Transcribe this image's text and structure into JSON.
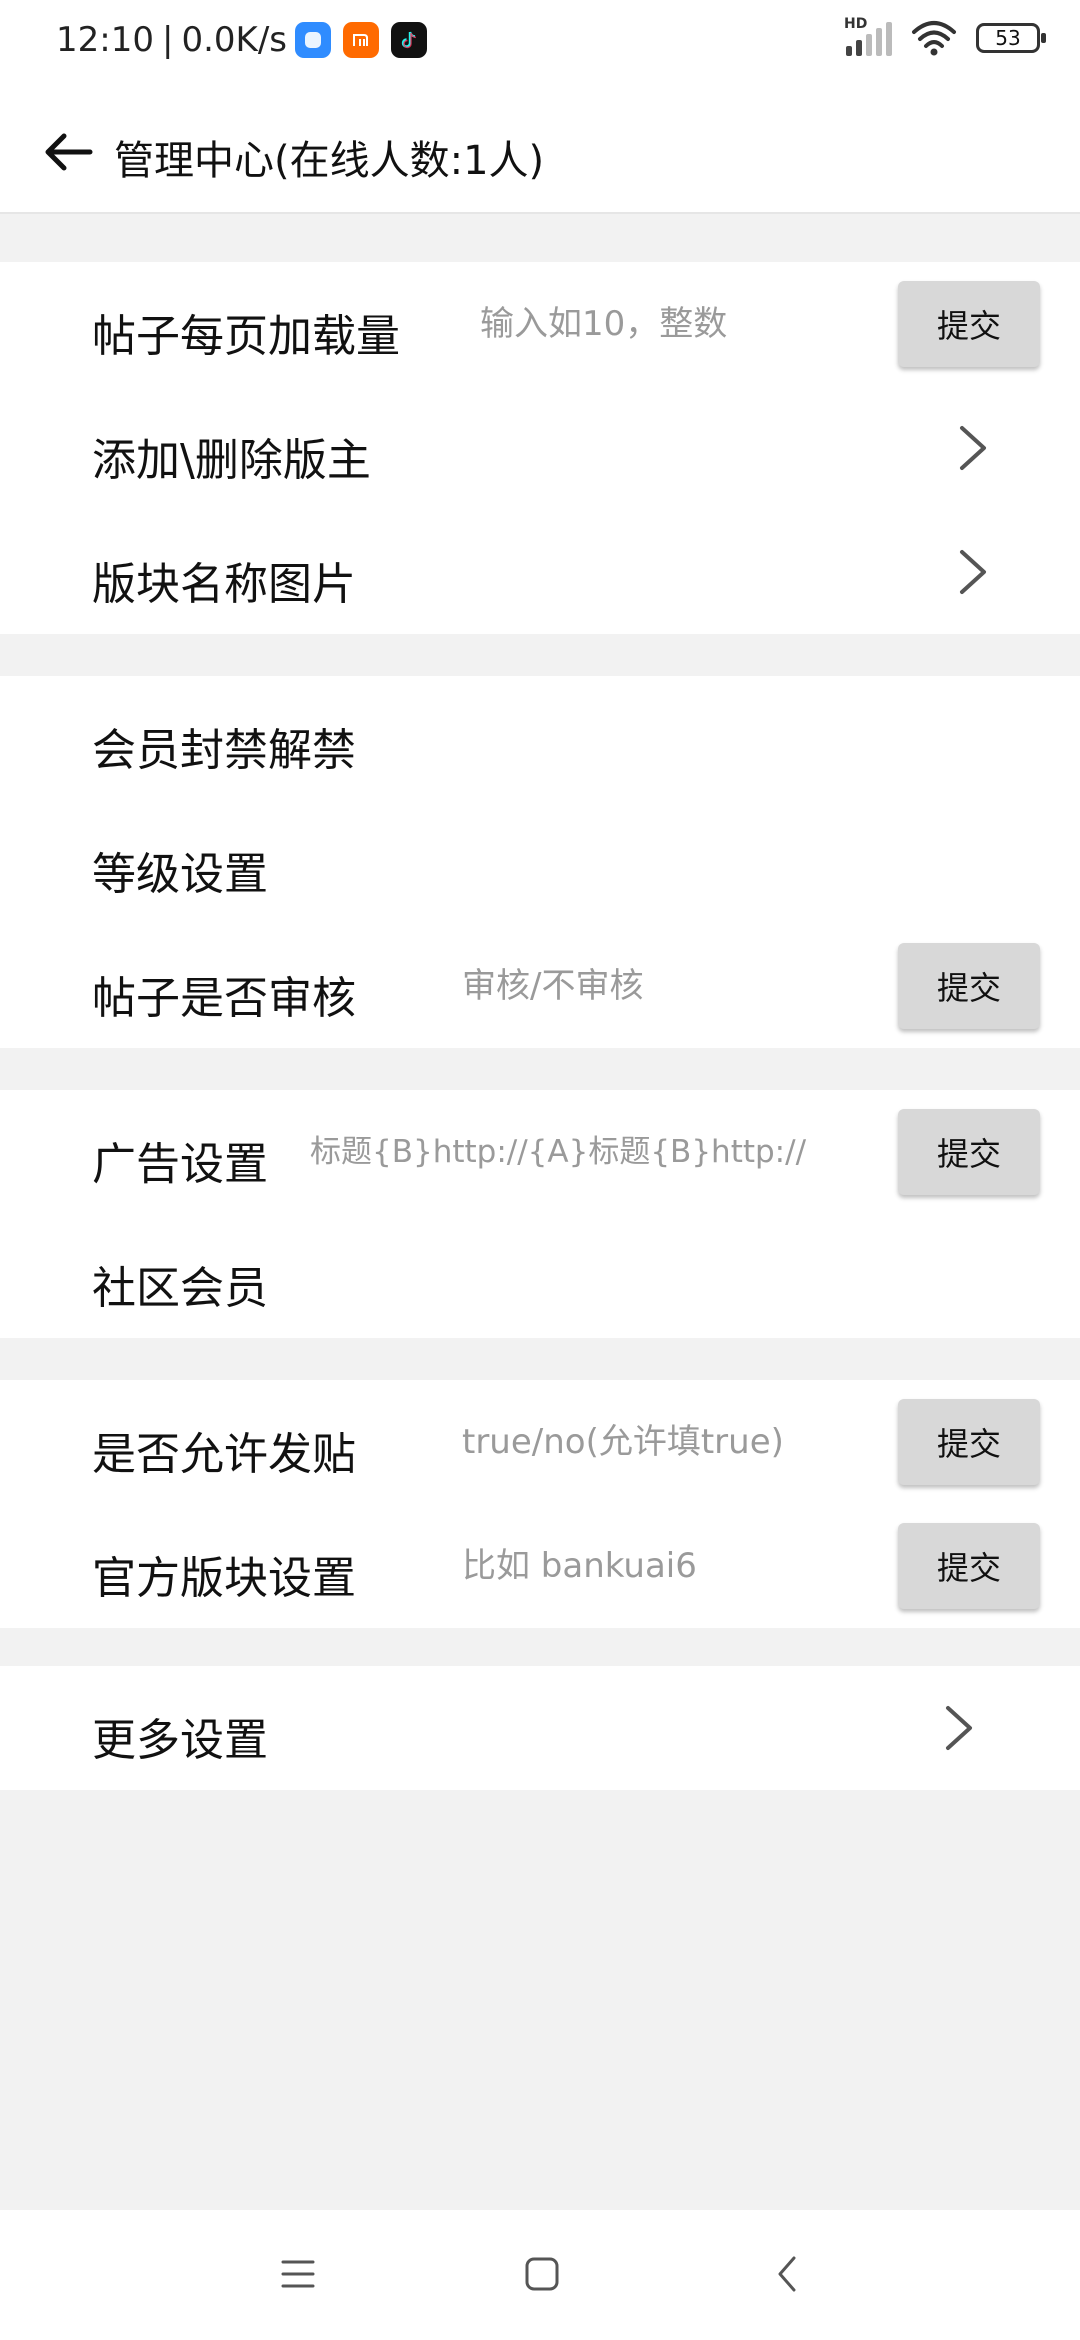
{
  "status_bar": {
    "time": "12:10",
    "separator": "|",
    "speed": "0.0K/s",
    "hd_label": "HD",
    "battery": "53",
    "icons": [
      "app-blue-icon",
      "xiaomi-mi-icon",
      "tiktok-icon",
      "signal-icon",
      "wifi-icon",
      "battery-icon"
    ]
  },
  "header": {
    "title": "管理中心(在线人数:1人)",
    "back_icon": "arrow-left-icon"
  },
  "colors": {
    "background": "#f2f2f2",
    "panel": "#ffffff",
    "button": "#d8d8d8",
    "placeholder": "#9a9a9a"
  },
  "sections": [
    {
      "rows": [
        {
          "label": "帖子每页加载量",
          "type": "input",
          "placeholder": "输入如10，整数",
          "button": "提交"
        },
        {
          "label": "添加\\删除版主",
          "type": "link"
        },
        {
          "label": "版块名称图片",
          "type": "link"
        }
      ]
    },
    {
      "rows": [
        {
          "label": "会员封禁解禁",
          "type": "text"
        },
        {
          "label": "等级设置",
          "type": "text"
        },
        {
          "label": "帖子是否审核",
          "type": "input",
          "placeholder": "审核/不审核",
          "button": "提交"
        }
      ]
    },
    {
      "rows": [
        {
          "label": "广告设置",
          "type": "input",
          "placeholder": "标题{B}http://{A}标题{B}http://",
          "button": "提交"
        },
        {
          "label": "社区会员",
          "type": "text"
        }
      ]
    },
    {
      "rows": [
        {
          "label": "是否允许发贴",
          "type": "input",
          "placeholder": "true/no(允许填true)",
          "button": "提交"
        },
        {
          "label": "官方版块设置",
          "type": "input",
          "placeholder": "比如 bankuai6",
          "button": "提交"
        }
      ]
    },
    {
      "rows": [
        {
          "label": "更多设置",
          "type": "link"
        }
      ]
    }
  ],
  "nav_bar": {
    "icons": [
      "menu-icon",
      "home-square-icon",
      "back-chevron-icon"
    ]
  }
}
